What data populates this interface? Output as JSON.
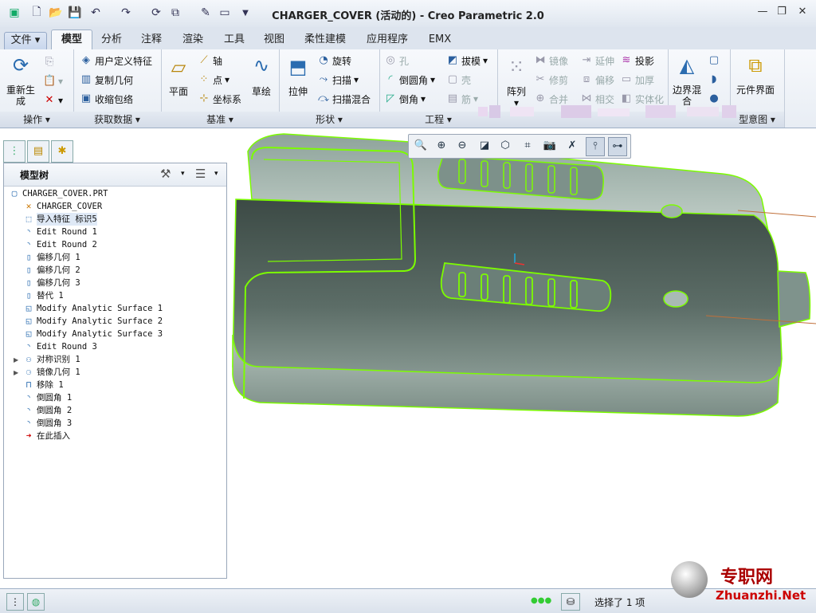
{
  "title": "CHARGER_COVER (活动的) - Creo Parametric 2.0",
  "tabs": [
    "文件",
    "模型",
    "分析",
    "注释",
    "渲染",
    "工具",
    "视图",
    "柔性建模",
    "应用程序",
    "EMX"
  ],
  "ribbon": {
    "operations": {
      "regen": "重新生成",
      "group": "操作"
    },
    "getdata": {
      "udf": "用户定义特征",
      "copygeom": "复制几何",
      "shrinkwrap": "收缩包络",
      "group": "获取数据"
    },
    "datum": {
      "plane": "平面",
      "axis": "轴",
      "point": "点",
      "csys": "坐标系",
      "sketch": "草绘",
      "group": "基准"
    },
    "shapes": {
      "extrude": "拉伸",
      "revolve": "旋转",
      "sweep": "扫描",
      "swept_blend": "扫描混合",
      "group": "形状"
    },
    "engineering": {
      "hole": "孔",
      "round": "倒圆角",
      "chamfer": "倒角",
      "draft": "拔模",
      "shell": "壳",
      "rib": "筋",
      "group": "工程"
    },
    "editing": {
      "pattern": "阵列",
      "mirror": "镜像",
      "trim": "修剪",
      "merge": "合并",
      "extend": "延伸",
      "offset": "偏移",
      "intersect": "相交",
      "project": "投影",
      "thicken": "加厚",
      "solidify": "实体化"
    },
    "surfaces": {
      "boundary_blend": "边界混合"
    },
    "component": {
      "interface": "元件界面",
      "group_partial": "型意图"
    }
  },
  "model_tree": {
    "title": "模型树",
    "items": [
      {
        "label": "CHARGER_COVER.PRT",
        "icon": "part-icon"
      },
      {
        "label": "CHARGER_COVER",
        "icon": "csys-icon"
      },
      {
        "label": "导入特征 标识5",
        "icon": "import-icon"
      },
      {
        "label": "Edit Round 1",
        "icon": "round-icon"
      },
      {
        "label": "Edit Round 2",
        "icon": "round-icon"
      },
      {
        "label": "偏移几何 1",
        "icon": "offset-icon"
      },
      {
        "label": "偏移几何 2",
        "icon": "offset-icon"
      },
      {
        "label": "偏移几何 3",
        "icon": "offset-icon"
      },
      {
        "label": "替代 1",
        "icon": "substitute-icon"
      },
      {
        "label": "Modify Analytic Surface 1",
        "icon": "surface-icon"
      },
      {
        "label": "Modify Analytic Surface 2",
        "icon": "surface-icon"
      },
      {
        "label": "Modify Analytic Surface 3",
        "icon": "surface-icon"
      },
      {
        "label": "Edit Round 3",
        "icon": "round-icon"
      },
      {
        "label": "对称识别 1",
        "icon": "symmetry-icon"
      },
      {
        "label": "镜像几何 1",
        "icon": "mirror-icon"
      },
      {
        "label": "移除 1",
        "icon": "remove-icon"
      },
      {
        "label": "倒圆角 1",
        "icon": "round-icon"
      },
      {
        "label": "倒圆角 2",
        "icon": "round-icon"
      },
      {
        "label": "倒圆角 3",
        "icon": "round-icon"
      },
      {
        "label": "在此插入",
        "icon": "insert-arrow-icon"
      }
    ]
  },
  "status": {
    "selected": "选择了 1 项"
  },
  "watermark": {
    "cn": "专职网",
    "en": "Zhuanzhi.Net"
  }
}
